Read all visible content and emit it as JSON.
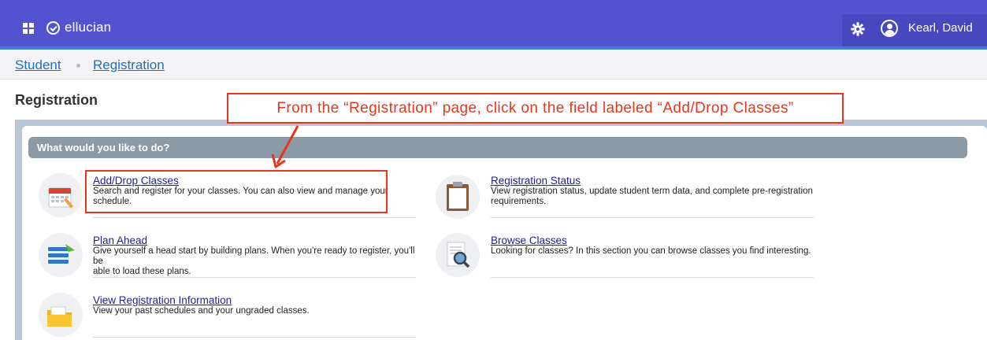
{
  "header": {
    "brand": "ellucian",
    "user_name": "Kearl, David"
  },
  "breadcrumb": {
    "items": [
      "Student",
      "Registration"
    ]
  },
  "page": {
    "title": "Registration"
  },
  "annotation": {
    "text": "From the “Registration” page, click on the field labeled “Add/Drop Classes”"
  },
  "section": {
    "title": "What would you like to do?"
  },
  "items": [
    {
      "label": "Add/Drop Classes",
      "desc_line1": "Search and register for your classes. You can also view and manage your",
      "desc_line2": "schedule.",
      "icon": "calendar-icon"
    },
    {
      "label": "Registration Status",
      "desc_line1": "View registration status, update student term data, and complete pre-registration",
      "desc_line2": "requirements.",
      "icon": "clipboard-icon"
    },
    {
      "label": "Plan Ahead",
      "desc_line1": "Give yourself a head start by building plans. When you're ready to register, you'll be",
      "desc_line2": "able to load these plans.",
      "icon": "list-icon"
    },
    {
      "label": "Browse Classes",
      "desc_line1": "Looking for classes? In this section you can browse classes you find interesting.",
      "desc_line2": "",
      "icon": "magnifier-icon"
    },
    {
      "label": "View Registration Information",
      "desc_line1": "View your past schedules and your ungraded classes.",
      "desc_line2": "",
      "icon": "folder-icon"
    }
  ],
  "colors": {
    "topbar": "#5353d1",
    "link": "#1d1d9e",
    "annotation": "#e8361e",
    "section_bar": "#8a9aa6"
  }
}
